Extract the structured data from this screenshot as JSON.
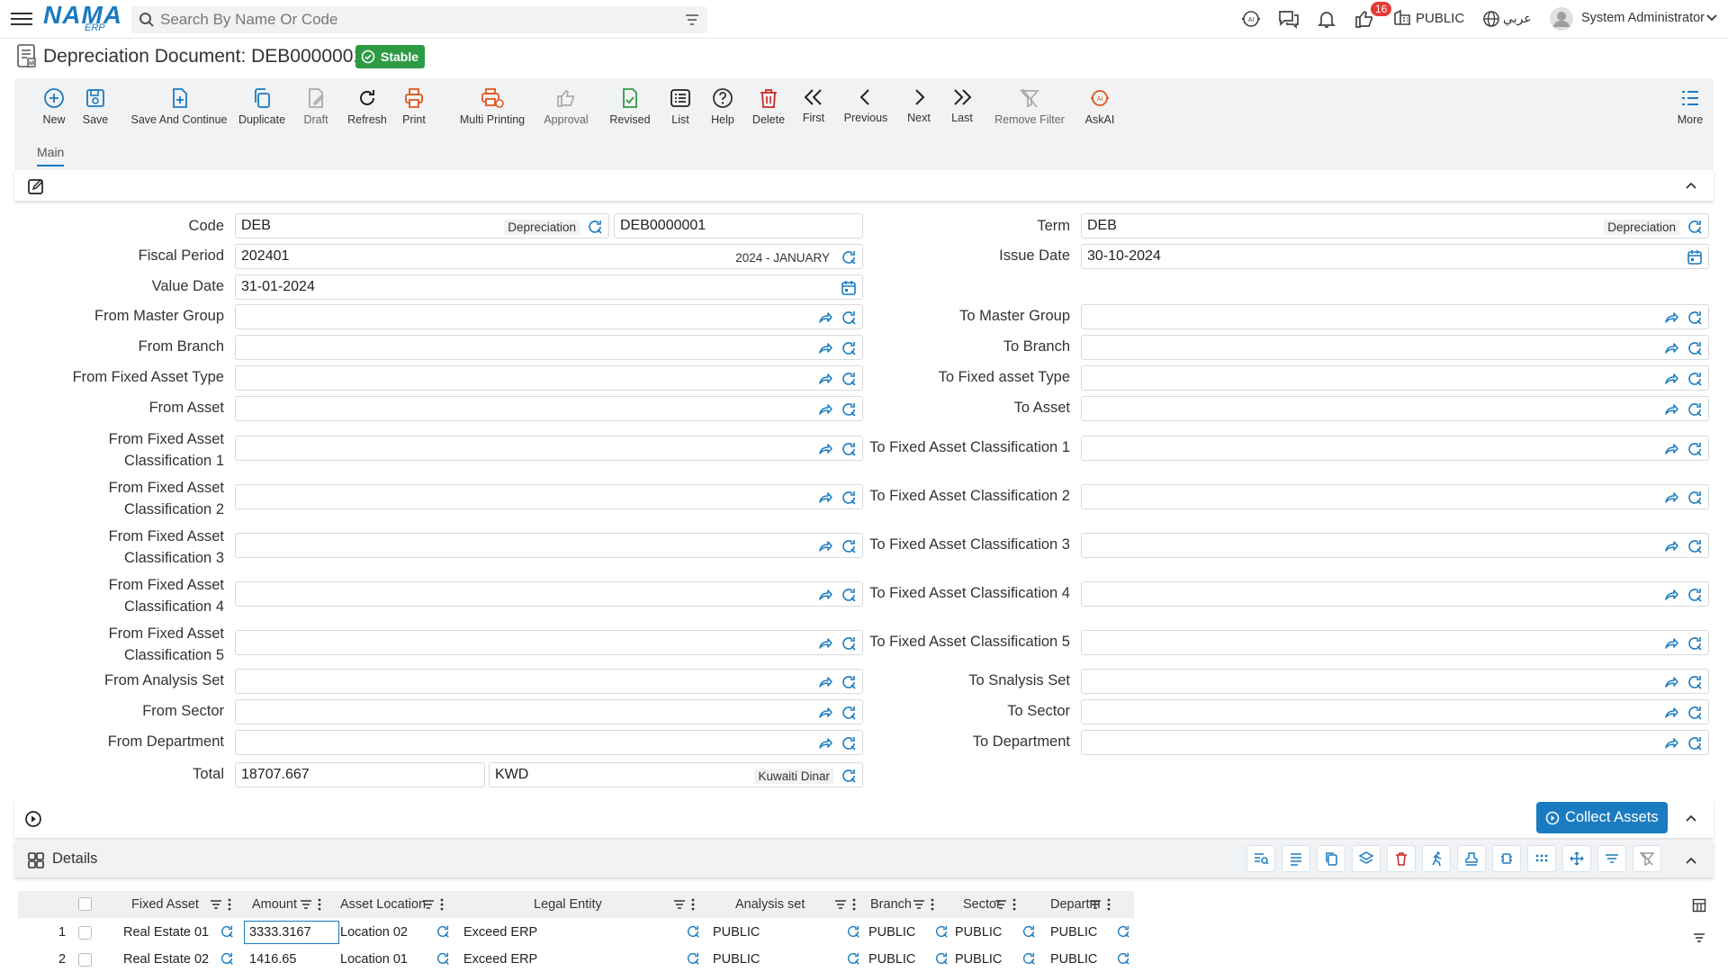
{
  "app": {
    "logo": "NAMA",
    "logo_sub": "ERP"
  },
  "search": {
    "placeholder": "Search By Name Or Code"
  },
  "header": {
    "notification_count": "16",
    "company": "PUBLIC",
    "language": "عربي",
    "user": "System Administrator"
  },
  "document": {
    "title": "Depreciation Document: DEB0000001",
    "status": "Stable"
  },
  "toolbar": {
    "new": "New",
    "save": "Save",
    "save_continue": "Save And Continue",
    "duplicate": "Duplicate",
    "draft": "Draft",
    "refresh": "Refresh",
    "print": "Print",
    "multi_printing": "Multi Printing",
    "approval": "Approval",
    "revised": "Revised",
    "list": "List",
    "help": "Help",
    "delete": "Delete",
    "first": "First",
    "previous": "Previous",
    "next": "Next",
    "last": "Last",
    "remove_filter": "Remove Filter",
    "askai": "AskAI",
    "more": "More"
  },
  "tabs": {
    "main": "Main"
  },
  "form": {
    "code": {
      "label": "Code",
      "value": "DEB",
      "hint": "Depreciation",
      "doc_no": "DEB0000001"
    },
    "term": {
      "label": "Term",
      "value": "DEB",
      "hint": "Depreciation"
    },
    "fiscal_period": {
      "label": "Fiscal Period",
      "value": "202401",
      "hint": "2024 - JANUARY"
    },
    "issue_date": {
      "label": "Issue Date",
      "value": "30-10-2024"
    },
    "value_date": {
      "label": "Value Date",
      "value": "31-01-2024"
    },
    "from_master_group": "From Master Group",
    "to_master_group": "To Master Group",
    "from_branch": "From Branch",
    "to_branch": "To Branch",
    "from_fixed_asset_type": "From Fixed Asset Type",
    "to_fixed_asset_type": "To Fixed asset Type",
    "from_asset": "From Asset",
    "to_asset": "To Asset",
    "from_class1_a": "From Fixed Asset",
    "from_class1_b": "Classification 1",
    "to_class1": "To Fixed Asset Classification 1",
    "from_class2_a": "From Fixed Asset",
    "from_class2_b": "Classification 2",
    "to_class2": "To Fixed Asset Classification 2",
    "from_class3_a": "From Fixed Asset",
    "from_class3_b": "Classification 3",
    "to_class3": "To Fixed Asset Classification 3",
    "from_class4_a": "From Fixed Asset",
    "from_class4_b": "Classification 4",
    "to_class4": "To Fixed Asset Classification 4",
    "from_class5_a": "From Fixed Asset",
    "from_class5_b": "Classification 5",
    "to_class5": "To Fixed Asset Classification 5",
    "from_analysis_set": "From Analysis Set",
    "to_analysis_set": "To Snalysis Set",
    "from_sector": "From Sector",
    "to_sector": "To Sector",
    "from_department": "From Department",
    "to_department": "To Department",
    "total": {
      "label": "Total",
      "value": "18707.667",
      "currency": "KWD",
      "currency_name": "Kuwaiti Dinar"
    }
  },
  "collect_assets": "Collect Assets",
  "details": {
    "title": "Details",
    "columns": [
      "Fixed Asset",
      "Amount",
      "Asset Location",
      "Legal Entity",
      "Analysis set",
      "Branch",
      "Sector",
      "Departm"
    ],
    "rows": [
      {
        "no": "1",
        "fixed_asset": "Real Estate 01",
        "amount": "3333.3167",
        "location": "Location 02",
        "legal_entity": "Exceed ERP",
        "analysis_set": "PUBLIC",
        "branch": "PUBLIC",
        "sector": "PUBLIC",
        "department": "PUBLIC"
      },
      {
        "no": "2",
        "fixed_asset": "Real Estate 02",
        "amount": "1416.65",
        "location": "Location 01",
        "legal_entity": "Exceed ERP",
        "analysis_set": "PUBLIC",
        "branch": "PUBLIC",
        "sector": "PUBLIC",
        "department": "PUBLIC"
      }
    ]
  }
}
